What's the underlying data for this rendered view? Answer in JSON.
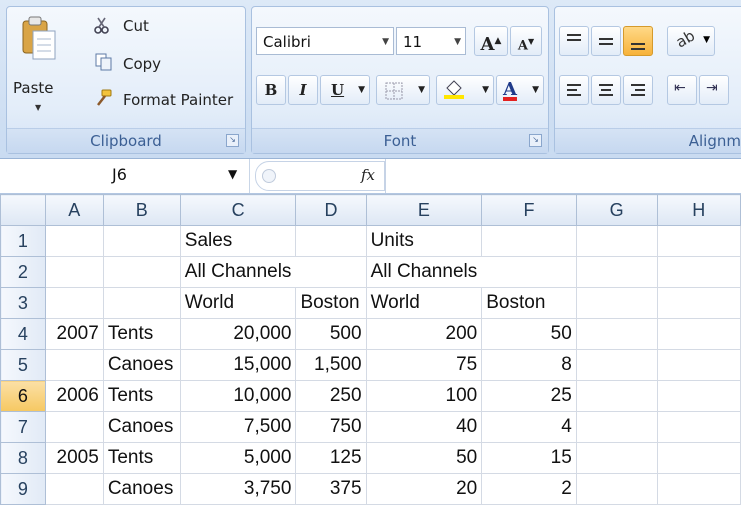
{
  "ribbon": {
    "clipboard": {
      "paste_label": "Paste",
      "cut_label": "Cut",
      "copy_label": "Copy",
      "format_painter_label": "Format Painter",
      "group_label": "Clipboard"
    },
    "font": {
      "font_name": "Calibri",
      "font_size": "11",
      "bold_label": "B",
      "italic_label": "I",
      "underline_label": "U",
      "font_color_label": "A",
      "grow_label": "A",
      "shrink_label": "A",
      "group_label": "Font"
    },
    "alignment": {
      "group_label": "Alignm"
    },
    "colors": {
      "fill_highlight": "#ffe600",
      "font_red": "#e32020",
      "accent": "#3b5f94"
    }
  },
  "formula_bar": {
    "name_box": "J6",
    "fx_label": "fx",
    "formula": ""
  },
  "sheet": {
    "columns": [
      "A",
      "B",
      "C",
      "D",
      "E",
      "F",
      "G",
      "H"
    ],
    "rows": [
      {
        "num": "1",
        "cells": [
          "",
          "",
          "Sales",
          "",
          "Units",
          "",
          "",
          ""
        ]
      },
      {
        "num": "2",
        "cells": [
          "",
          "",
          "All Channels",
          "",
          "All Channels",
          "",
          "",
          ""
        ]
      },
      {
        "num": "3",
        "cells": [
          "",
          "",
          "World",
          "Boston",
          "World",
          "Boston",
          "",
          ""
        ]
      },
      {
        "num": "4",
        "cells": [
          "2007",
          "Tents",
          "20,000",
          "500",
          "200",
          "50",
          "",
          ""
        ]
      },
      {
        "num": "5",
        "cells": [
          "",
          "Canoes",
          "15,000",
          "1,500",
          "75",
          "8",
          "",
          ""
        ]
      },
      {
        "num": "6",
        "cells": [
          "2006",
          "Tents",
          "10,000",
          "250",
          "100",
          "25",
          "",
          ""
        ]
      },
      {
        "num": "7",
        "cells": [
          "",
          "Canoes",
          "7,500",
          "750",
          "40",
          "4",
          "",
          ""
        ]
      },
      {
        "num": "8",
        "cells": [
          "2005",
          "Tents",
          "5,000",
          "125",
          "50",
          "15",
          "",
          ""
        ]
      },
      {
        "num": "9",
        "cells": [
          "",
          "Canoes",
          "3,750",
          "375",
          "20",
          "2",
          "",
          ""
        ]
      }
    ],
    "selected_row": "6"
  }
}
